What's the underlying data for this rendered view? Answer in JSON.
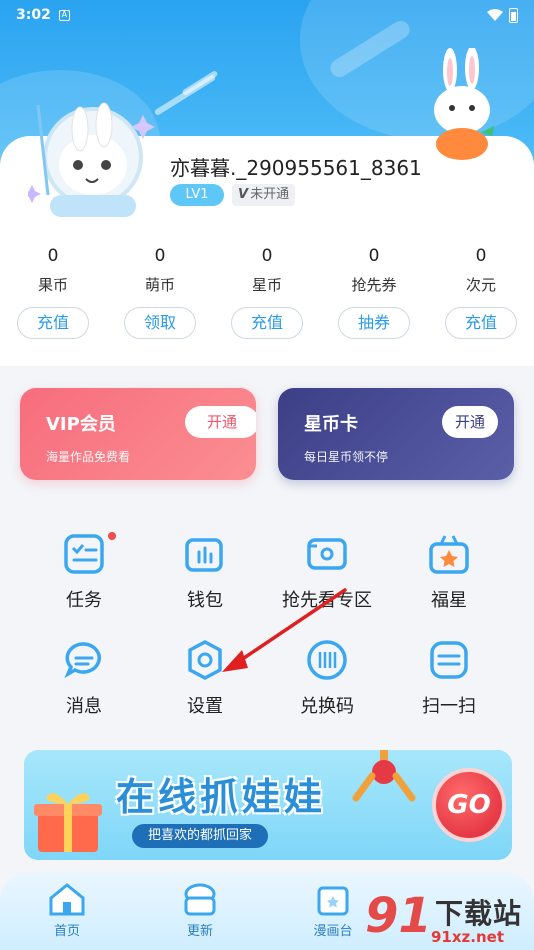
{
  "status_bar": {
    "time": "3:02",
    "notification_icon": "A"
  },
  "profile": {
    "username": "亦暮暮._290955561_8361",
    "level": "LV1",
    "vip_status": "未开通"
  },
  "stats": [
    {
      "value": "0",
      "label": "果币",
      "action": "充值"
    },
    {
      "value": "0",
      "label": "萌币",
      "action": "领取"
    },
    {
      "value": "0",
      "label": "星币",
      "action": "充值"
    },
    {
      "value": "0",
      "label": "抢先券",
      "action": "抽券"
    },
    {
      "value": "0",
      "label": "次元",
      "action": "充值"
    }
  ],
  "promos": {
    "vip": {
      "title": "VIP会员",
      "subtitle": "海量作品免费看",
      "button": "开通"
    },
    "star": {
      "title": "星币卡",
      "subtitle": "每日星币领不停",
      "button": "开通"
    }
  },
  "grid": [
    {
      "label": "任务",
      "icon": "task-icon"
    },
    {
      "label": "钱包",
      "icon": "wallet-icon"
    },
    {
      "label": "抢先看专区",
      "icon": "preview-icon"
    },
    {
      "label": "福星",
      "icon": "lucky-star-icon"
    },
    {
      "label": "消息",
      "icon": "message-icon"
    },
    {
      "label": "设置",
      "icon": "settings-icon"
    },
    {
      "label": "兑换码",
      "icon": "redeem-code-icon"
    },
    {
      "label": "扫一扫",
      "icon": "scan-icon"
    }
  ],
  "banner": {
    "title": "在线抓娃娃",
    "subtitle": "把喜欢的都抓回家",
    "go": "GO"
  },
  "tabbar": [
    {
      "label": "首页",
      "icon": "home-icon"
    },
    {
      "label": "更新",
      "icon": "update-icon"
    },
    {
      "label": "漫画台",
      "icon": "comic-stage-icon"
    }
  ],
  "watermark": {
    "text": "下载站",
    "url": "91xz.net",
    "logo": "91"
  },
  "colors": {
    "accent": "#2a9be8",
    "vip": "#f76d7e",
    "star": "#3c3f86",
    "icon_blue": "#3aa7f0"
  }
}
